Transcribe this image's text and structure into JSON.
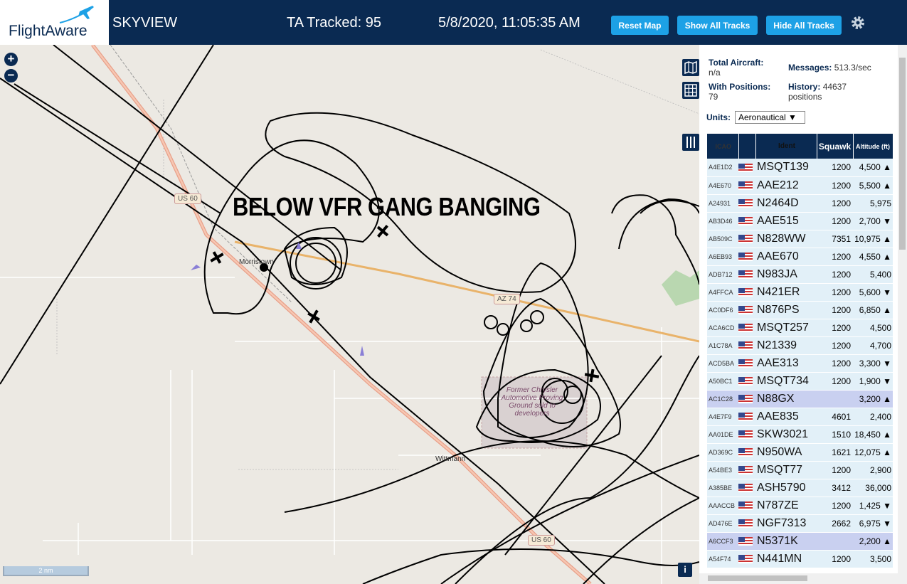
{
  "header": {
    "logo": "FlightAware",
    "app_title": "SKYVIEW",
    "ta_tracked": "TA Tracked: 95",
    "clock": "5/8/2020, 11:05:35 AM",
    "buttons": {
      "reset": "Reset Map",
      "show": "Show All Tracks",
      "hide": "Hide All Tracks"
    }
  },
  "map": {
    "overlay_text": "BELOW VFR GANG BANGING",
    "labels": {
      "morristown": "Morristown",
      "wittmann": "Wittmann",
      "chrysler": "Former Chrysler Automotive Proving Ground sold to developers",
      "us60_a": "US 60",
      "us60_b": "US 60",
      "az74": "AZ 74"
    },
    "scale": "2 nm",
    "zoom_in": "+",
    "zoom_out": "−",
    "info": "i"
  },
  "stats": {
    "total_label": "Total Aircraft:",
    "total_value": "n/a",
    "positions_label": "With Positions:",
    "positions_value": "79",
    "messages_label": "Messages:",
    "messages_value": "513.3/sec",
    "history_label": "History:",
    "history_value": "44637",
    "history_unit": "positions"
  },
  "units": {
    "label": "Units:",
    "value": "Aeronautical ▼"
  },
  "table": {
    "headers": {
      "icao": "ICAO",
      "ident": "Ident",
      "squawk": "Squawk",
      "altitude": "Altitude (ft)"
    },
    "rows": [
      {
        "icao": "A4E1D2",
        "ident": "MSQT139",
        "squawk": "1200",
        "alt": "4,500 ▲"
      },
      {
        "icao": "A4E670",
        "ident": "AAE212",
        "squawk": "1200",
        "alt": "5,500 ▲"
      },
      {
        "icao": "A24931",
        "ident": "N2464D",
        "squawk": "1200",
        "alt": "5,975"
      },
      {
        "icao": "AB3D46",
        "ident": "AAE515",
        "squawk": "1200",
        "alt": "2,700 ▼"
      },
      {
        "icao": "AB509C",
        "ident": "N828WW",
        "squawk": "7351",
        "alt": "10,975 ▲"
      },
      {
        "icao": "A6EB93",
        "ident": "AAE670",
        "squawk": "1200",
        "alt": "4,550 ▲"
      },
      {
        "icao": "ADB712",
        "ident": "N983JA",
        "squawk": "1200",
        "alt": "5,400"
      },
      {
        "icao": "A4FFCA",
        "ident": "N421ER",
        "squawk": "1200",
        "alt": "5,600 ▼"
      },
      {
        "icao": "AC0DF6",
        "ident": "N876PS",
        "squawk": "1200",
        "alt": "6,850 ▲"
      },
      {
        "icao": "ACA6CD",
        "ident": "MSQT257",
        "squawk": "1200",
        "alt": "4,500"
      },
      {
        "icao": "A1C78A",
        "ident": "N21339",
        "squawk": "1200",
        "alt": "4,700"
      },
      {
        "icao": "ACD5BA",
        "ident": "AAE313",
        "squawk": "1200",
        "alt": "3,300 ▼"
      },
      {
        "icao": "A50BC1",
        "ident": "MSQT734",
        "squawk": "1200",
        "alt": "1,900 ▼"
      },
      {
        "icao": "AC1C28",
        "ident": "N88GX",
        "squawk": "",
        "alt": "3,200 ▲"
      },
      {
        "icao": "A4E7F9",
        "ident": "AAE835",
        "squawk": "4601",
        "alt": "2,400"
      },
      {
        "icao": "AA01DE",
        "ident": "SKW3021",
        "squawk": "1510",
        "alt": "18,450 ▲"
      },
      {
        "icao": "AD369C",
        "ident": "N950WA",
        "squawk": "1621",
        "alt": "12,075 ▲"
      },
      {
        "icao": "A54BE3",
        "ident": "MSQT77",
        "squawk": "1200",
        "alt": "2,900"
      },
      {
        "icao": "A385BE",
        "ident": "ASH5790",
        "squawk": "3412",
        "alt": "36,000"
      },
      {
        "icao": "AAACCB",
        "ident": "N787ZE",
        "squawk": "1200",
        "alt": "1,425 ▼"
      },
      {
        "icao": "AD476E",
        "ident": "NGF7313",
        "squawk": "2662",
        "alt": "6,975 ▼"
      },
      {
        "icao": "A6CCF3",
        "ident": "N5371K",
        "squawk": "",
        "alt": "2,200 ▲"
      },
      {
        "icao": "A54F74",
        "ident": "N441MN",
        "squawk": "1200",
        "alt": "3,500"
      }
    ]
  }
}
